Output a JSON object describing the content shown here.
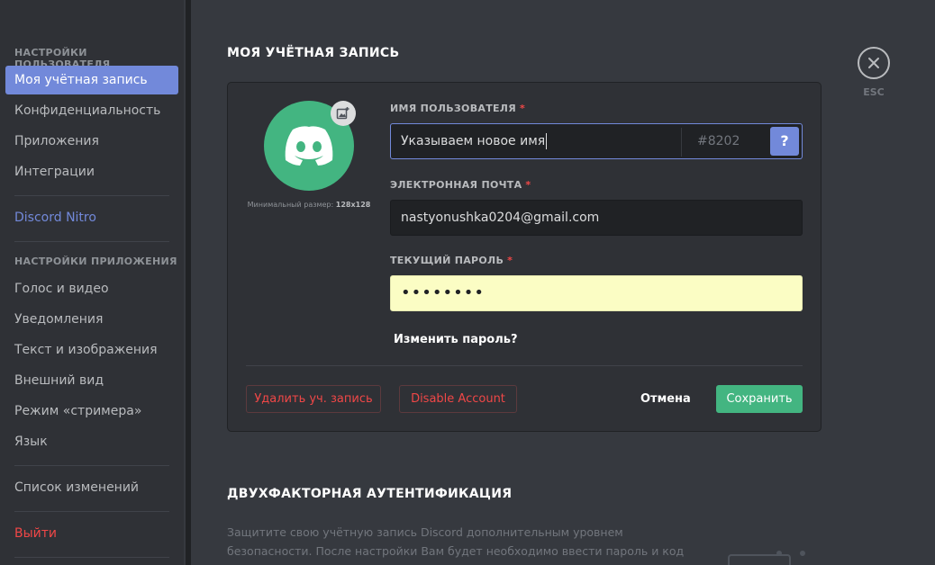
{
  "sidebar": {
    "user_settings_header": "НАСТРОЙКИ ПОЛЬЗОВАТЕЛЯ",
    "user_items": [
      "Моя учётная запись",
      "Конфиденциальность",
      "Приложения",
      "Интеграции"
    ],
    "nitro": "Discord Nitro",
    "app_settings_header": "НАСТРОЙКИ ПРИЛОЖЕНИЯ",
    "app_items": [
      "Голос и видео",
      "Уведомления",
      "Текст и изображения",
      "Внешний вид",
      "Режим «стримера»",
      "Язык"
    ],
    "changelog": "Список изменений",
    "logout": "Выйти"
  },
  "page": {
    "title": "МОЯ УЧЁТНАЯ ЗАПИСЬ",
    "close_label": "ESC"
  },
  "account": {
    "avatar_hint_prefix": "Минимальный размер:",
    "avatar_hint_size": "128x128",
    "username_label": "ИМЯ ПОЛЬЗОВАТЕЛЯ",
    "username_value": "Указываем новое имя",
    "discriminator": "#8202",
    "help": "?",
    "email_label": "ЭЛЕКТРОННАЯ ПОЧТА",
    "email_value": "nastyonushka0204@gmail.com",
    "password_label": "ТЕКУЩИЙ ПАРОЛЬ",
    "password_value": "••••••••",
    "required_mark": "*",
    "change_password": "Изменить пароль?",
    "delete_account": "Удалить уч. запись",
    "disable_account": "Disable Account",
    "cancel": "Отмена",
    "save": "Сохранить"
  },
  "tfa": {
    "title": "ДВУХФАКТОРНАЯ АУТЕНТИФИКАЦИЯ",
    "description": "Защитите свою учётную запись Discord дополнительным уровнем безопасности. После настройки Вам будет необходимо ввести пароль и код подтверждения со"
  },
  "colors": {
    "accent": "#7289da",
    "success": "#43b581",
    "danger": "#f04747"
  }
}
